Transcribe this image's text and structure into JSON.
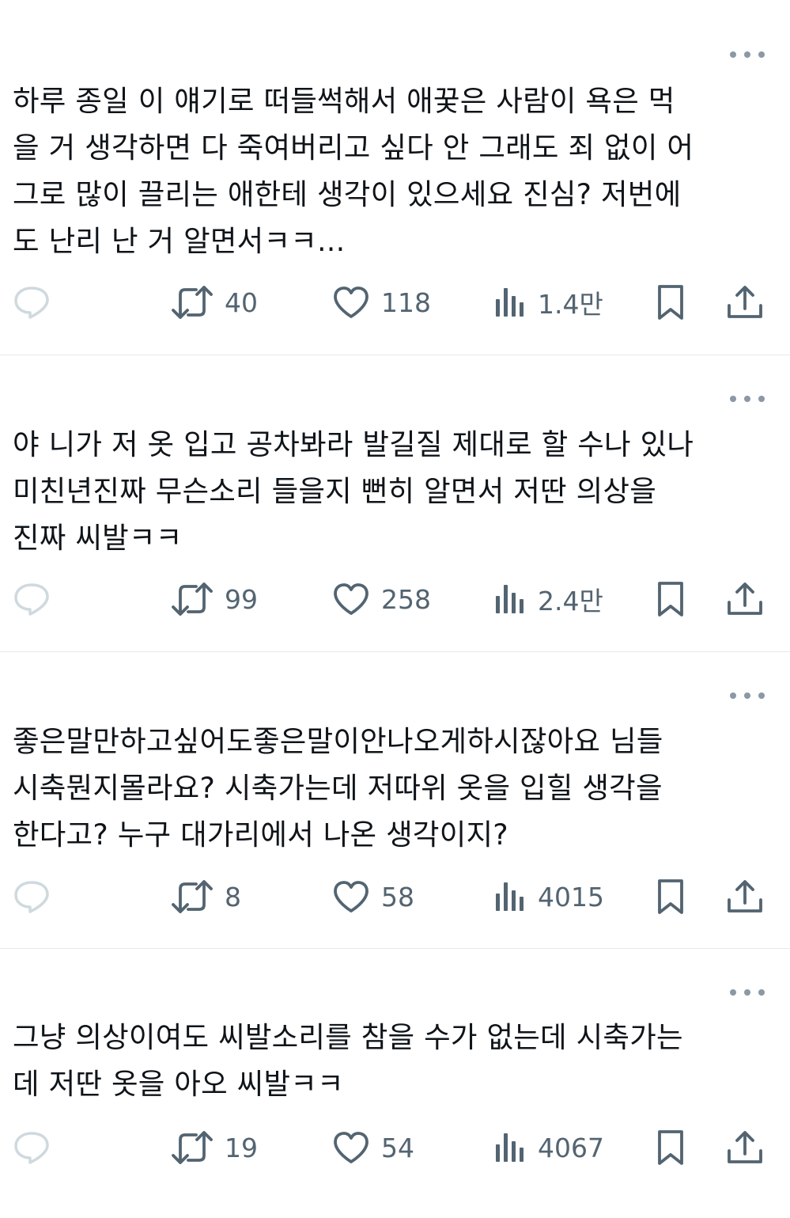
{
  "icons": {
    "reply": "reply-icon",
    "more": "more-dots-icon",
    "retweet": "retweet-icon",
    "like": "heart-icon",
    "views": "views-bar-chart-icon",
    "bookmark": "bookmark-icon",
    "share": "share-icon"
  },
  "colors": {
    "text": "#0f1419",
    "secondary": "#536471",
    "divider": "#e6e9ec",
    "dots": "#8b98a5"
  },
  "tweets": [
    {
      "text": "하루 종일 이 얘기로 떠들썩해서 애꿎은 사람이 욕은 먹\n을 거 생각하면 다 죽여버리고 싶다 안 그래도 죄 없이 어\n그로 많이 끌리는 애한테 생각이 있으세요 진심? 저번에\n도 난리 난 거 알면서ㅋㅋ...",
      "retweets": "40",
      "likes": "118",
      "views": "1.4만"
    },
    {
      "text": "야 니가 저 옷 입고 공차봐라 발길질 제대로 할 수나 있나\n미친년진짜 무슨소리 들을지 뻔히 알면서 저딴 의상을\n진짜 씨발ㅋㅋ",
      "retweets": "99",
      "likes": "258",
      "views": "2.4만"
    },
    {
      "text": "좋은말만하고싶어도좋은말이안나오게하시잖아요 님들\n시축뭔지몰라요? 시축가는데 저따위 옷을 입힐 생각을\n한다고? 누구 대가리에서 나온 생각이지?",
      "retweets": "8",
      "likes": "58",
      "views": "4015"
    },
    {
      "text": "그냥 의상이여도 씨발소리를 참을 수가 없는데 시축가는\n데 저딴 옷을 아오 씨발ㅋㅋ",
      "retweets": "19",
      "likes": "54",
      "views": "4067"
    }
  ]
}
